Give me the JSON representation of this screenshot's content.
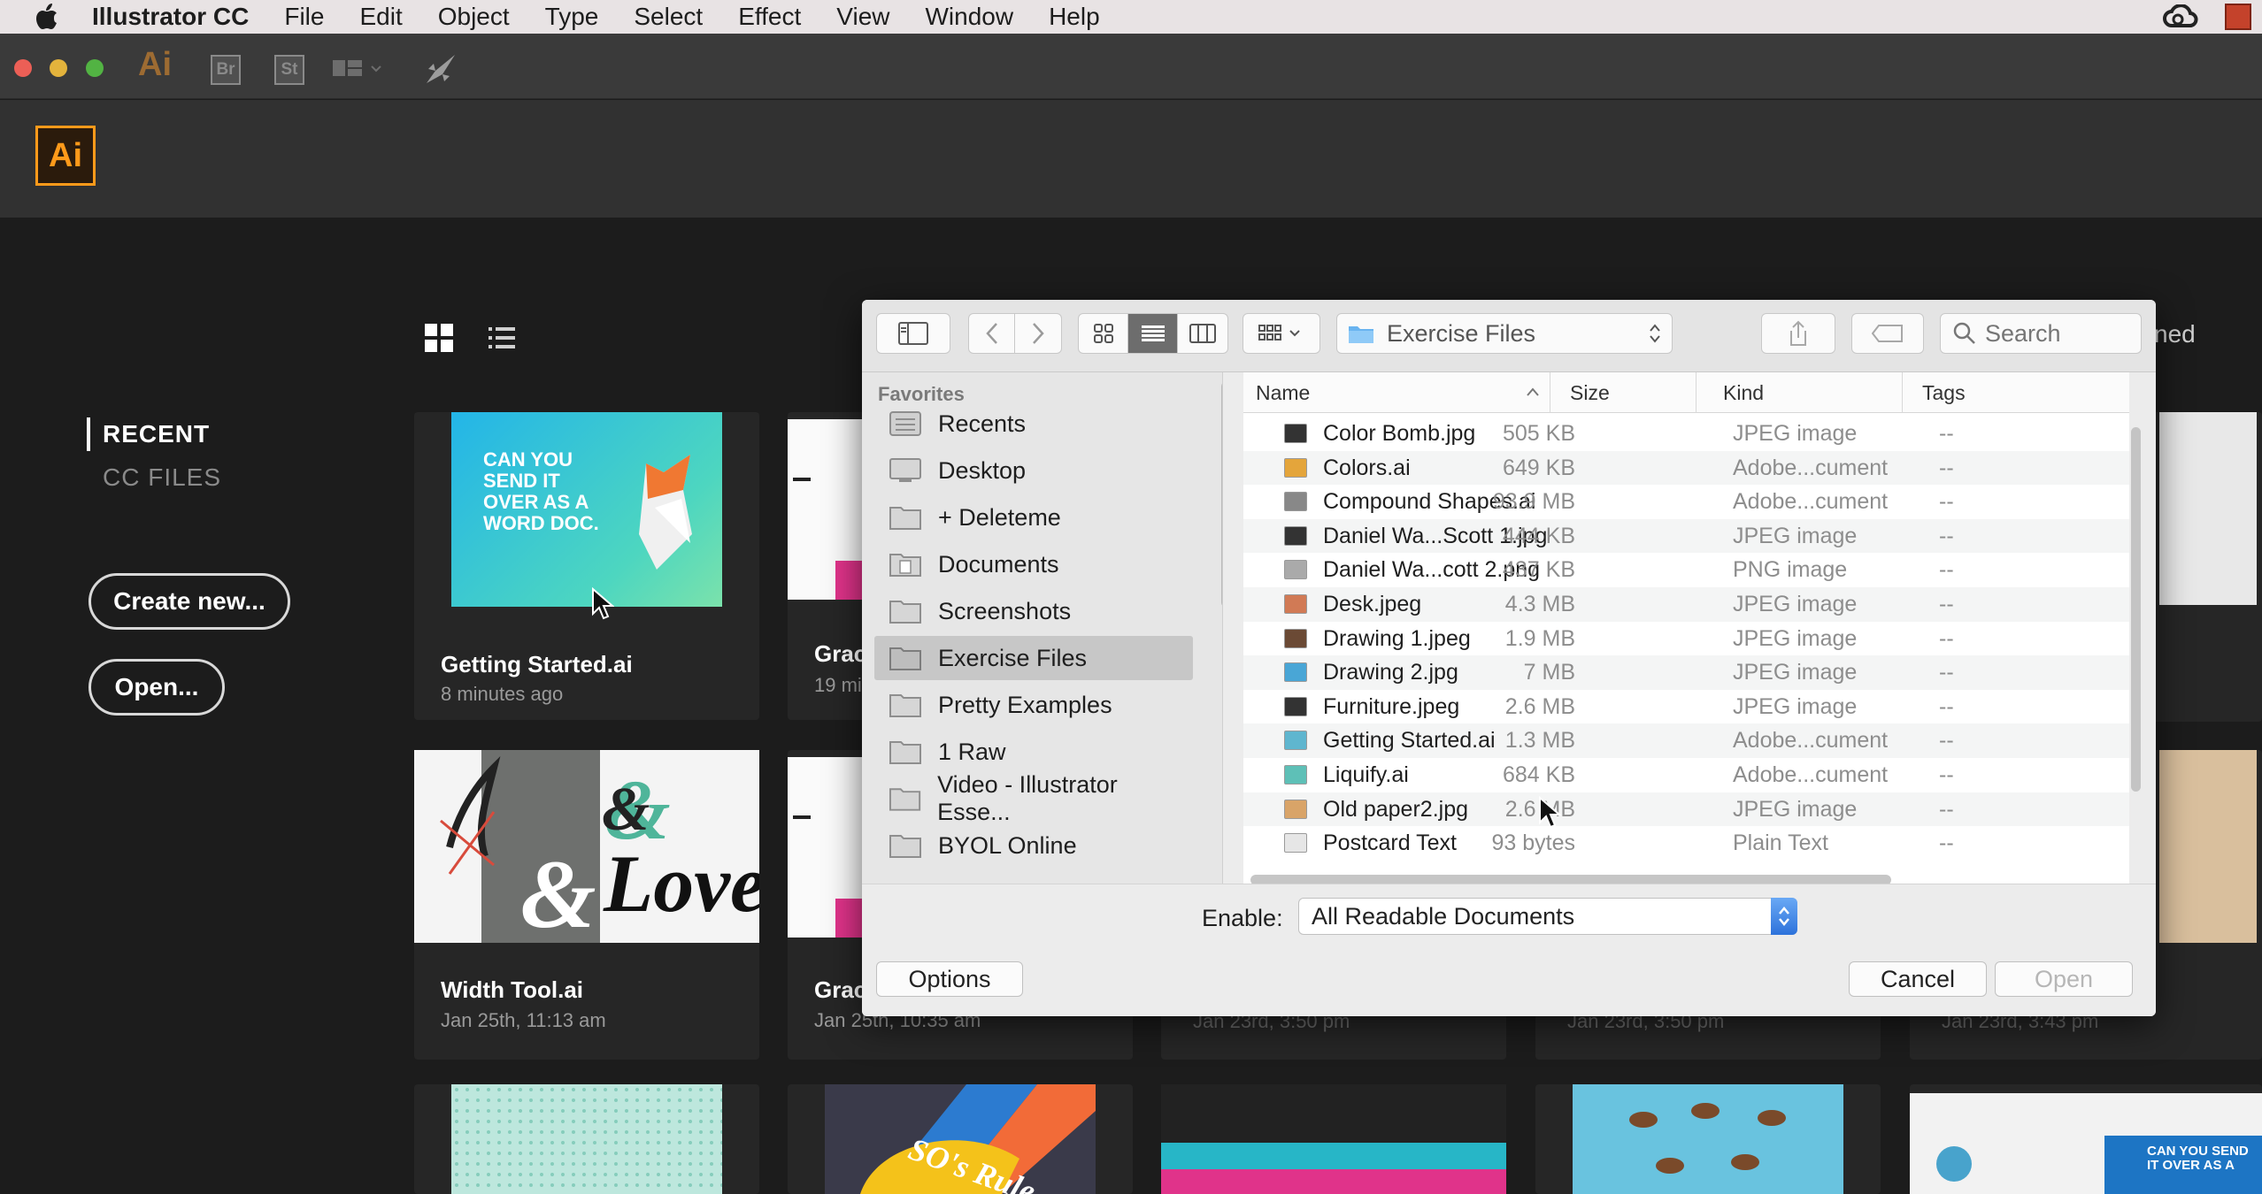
{
  "menubar": {
    "app_name": "Illustrator CC",
    "items": [
      "File",
      "Edit",
      "Object",
      "Type",
      "Select",
      "Effect",
      "View",
      "Window",
      "Help"
    ]
  },
  "apptoolbar": {
    "ai_label": "Ai",
    "bridge_label": "Br",
    "stock_label": "St"
  },
  "header": {
    "logo_text": "Ai",
    "accent_color": "#ff9a1a"
  },
  "start": {
    "nav_recent": "RECENT",
    "nav_cc_files": "CC FILES",
    "create_new": "Create new...",
    "open": "Open...",
    "partial_right_text": "ned",
    "cards": [
      {
        "title": "Getting Started.ai",
        "sub": "8 minutes ago",
        "thumb_text": "CAN YOU SEND IT OVER AS A WORD DOC."
      },
      {
        "title": "Grac",
        "sub": "19 mi"
      },
      {
        "title": "Width Tool.ai",
        "sub": "Jan 25th, 11:13 am",
        "thumb_text": "Love"
      },
      {
        "title": "Grac",
        "sub": "Jan 25th, 10:35 am"
      },
      {
        "sub": "Jan 23rd, 3:50 pm"
      },
      {
        "sub": "Jan 23rd, 3:50 pm"
      },
      {
        "sub": "Jan 23rd, 3:43 pm"
      }
    ],
    "bottom_thumb_text": "SO's Rule",
    "bottom_right_thumb_text": "CAN YOU SEND IT OVER AS A"
  },
  "dialog": {
    "location": "Exercise Files",
    "search_placeholder": "Search",
    "favorites_heading": "Favorites",
    "favorites": [
      "Recents",
      "Desktop",
      "+ Deleteme",
      "Documents",
      "Screenshots",
      "Exercise Files",
      "Pretty Examples",
      "1 Raw",
      "Video - Illustrator Esse...",
      "BYOL Online"
    ],
    "selected_favorite": "Exercise Files",
    "columns": {
      "name": "Name",
      "size": "Size",
      "kind": "Kind",
      "tags": "Tags"
    },
    "files": [
      {
        "name": "Color Bomb.jpg",
        "size": "505 KB",
        "kind": "JPEG image",
        "tags": "--"
      },
      {
        "name": "Colors.ai",
        "size": "649 KB",
        "kind": "Adobe...cument",
        "tags": "--"
      },
      {
        "name": "Compound Shapes.ai",
        "size": "93.9 MB",
        "kind": "Adobe...cument",
        "tags": "--"
      },
      {
        "name": "Daniel Wa...Scott 1.jpg",
        "size": "444 KB",
        "kind": "JPEG image",
        "tags": "--"
      },
      {
        "name": "Daniel Wa...cott 2.png",
        "size": "437 KB",
        "kind": "PNG image",
        "tags": "--"
      },
      {
        "name": "Desk.jpeg",
        "size": "4.3 MB",
        "kind": "JPEG image",
        "tags": "--"
      },
      {
        "name": "Drawing 1.jpeg",
        "size": "1.9 MB",
        "kind": "JPEG image",
        "tags": "--"
      },
      {
        "name": "Drawing 2.jpg",
        "size": "7 MB",
        "kind": "JPEG image",
        "tags": "--"
      },
      {
        "name": "Furniture.jpeg",
        "size": "2.6 MB",
        "kind": "JPEG image",
        "tags": "--"
      },
      {
        "name": "Getting Started.ai",
        "size": "1.3 MB",
        "kind": "Adobe...cument",
        "tags": "--"
      },
      {
        "name": "Liquify.ai",
        "size": "684 KB",
        "kind": "Adobe...cument",
        "tags": "--"
      },
      {
        "name": "Old paper2.jpg",
        "size": "2.6 MB",
        "kind": "JPEG image",
        "tags": "--"
      },
      {
        "name": "Postcard Text",
        "size": "93 bytes",
        "kind": "Plain Text",
        "tags": "--"
      }
    ],
    "enable_label": "Enable:",
    "enable_value": "All Readable Documents",
    "options_button": "Options",
    "cancel_button": "Cancel",
    "open_button": "Open"
  }
}
